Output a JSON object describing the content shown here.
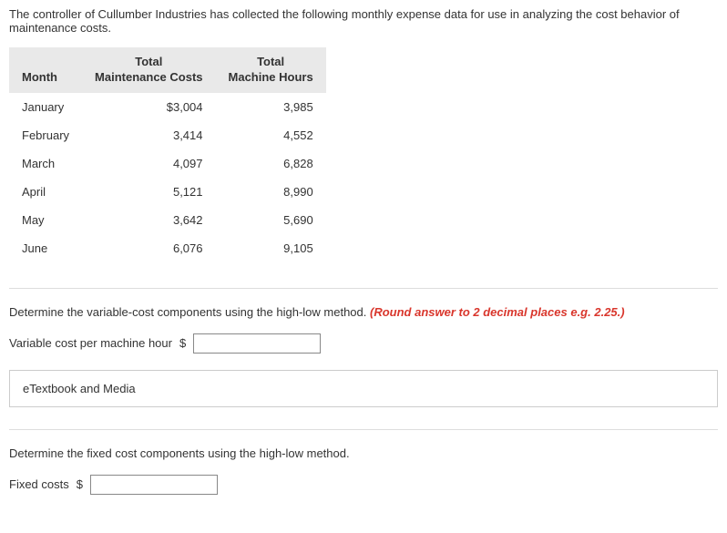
{
  "intro": "The controller of Cullumber Industries has collected the following monthly expense data for use in analyzing the cost behavior of maintenance costs.",
  "table": {
    "headers": {
      "month": "Month",
      "cost_top": "Total",
      "cost_bottom": "Maintenance Costs",
      "hours_top": "Total",
      "hours_bottom": "Machine Hours"
    },
    "rows": [
      {
        "month": "January",
        "cost": "$3,004",
        "hours": "3,985"
      },
      {
        "month": "February",
        "cost": "3,414",
        "hours": "4,552"
      },
      {
        "month": "March",
        "cost": "4,097",
        "hours": "6,828"
      },
      {
        "month": "April",
        "cost": "5,121",
        "hours": "8,990"
      },
      {
        "month": "May",
        "cost": "3,642",
        "hours": "5,690"
      },
      {
        "month": "June",
        "cost": "6,076",
        "hours": "9,105"
      }
    ]
  },
  "q1": {
    "prompt_main": "Determine the variable-cost components using the high-low method. ",
    "prompt_hint": "(Round answer to 2 decimal places e.g. 2.25.)",
    "field_label": "Variable cost per machine hour",
    "currency": "$"
  },
  "etextbook_label": "eTextbook and Media",
  "q2": {
    "prompt": "Determine the fixed cost components using the high-low method.",
    "field_label": "Fixed costs",
    "currency": "$"
  }
}
